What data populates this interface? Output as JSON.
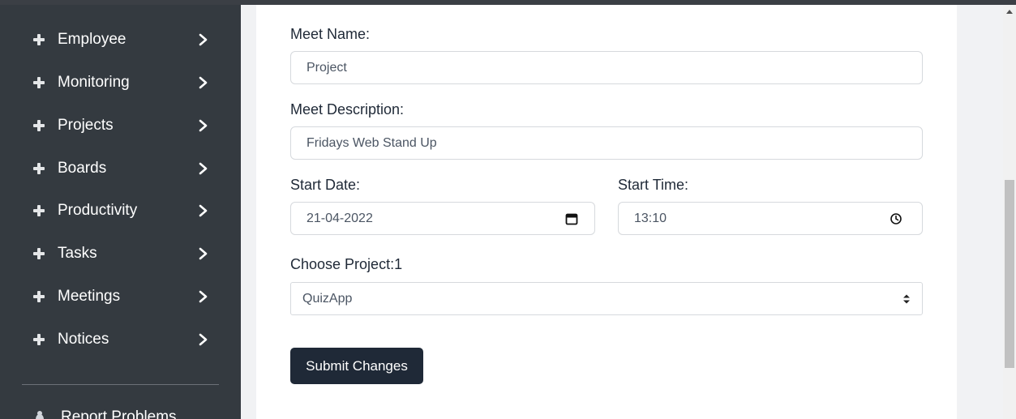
{
  "sidebar": {
    "items": [
      {
        "label": "Employee"
      },
      {
        "label": "Monitoring"
      },
      {
        "label": "Projects"
      },
      {
        "label": "Boards"
      },
      {
        "label": "Productivity"
      },
      {
        "label": "Tasks"
      },
      {
        "label": "Meetings"
      },
      {
        "label": "Notices"
      }
    ],
    "report_label": "Report Problems"
  },
  "form": {
    "meet_name_label": "Meet Name:",
    "meet_name_value": "Project",
    "meet_description_label": "Meet Description:",
    "meet_description_value": "Fridays Web Stand Up",
    "start_date_label": "Start Date:",
    "start_date_value": "21-04-2022",
    "start_time_label": "Start Time:",
    "start_time_value": "13:10",
    "project_label": "Choose Project:1",
    "project_value": "QuizApp",
    "submit_label": "Submit Changes"
  },
  "colors": {
    "sidebar_bg": "#343a40",
    "button_bg": "#1f2937",
    "page_bg": "#f1f2f4"
  }
}
